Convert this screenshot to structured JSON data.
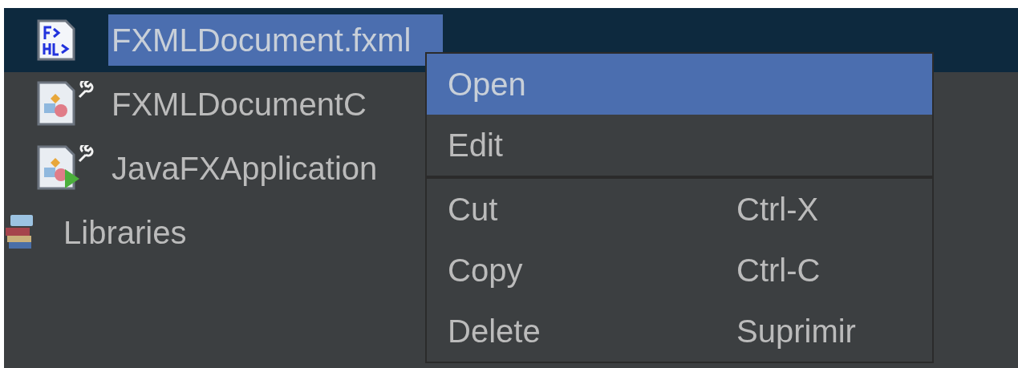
{
  "tree": {
    "items": [
      {
        "label": "FXMLDocument.fxml",
        "kind": "fxml",
        "selected": true
      },
      {
        "label": "FXMLDocumentC",
        "kind": "java",
        "selected": false
      },
      {
        "label": "JavaFXApplication",
        "kind": "java-main",
        "selected": false
      },
      {
        "label": "Libraries",
        "kind": "libraries",
        "selected": false
      }
    ]
  },
  "context_menu": {
    "items": [
      {
        "kind": "item",
        "label": "Open",
        "selected": true
      },
      {
        "kind": "item",
        "label": "Edit",
        "selected": false
      },
      {
        "kind": "separator"
      },
      {
        "kind": "item",
        "label": "Cut",
        "shortcut": "Ctrl-X",
        "selected": false
      },
      {
        "kind": "item",
        "label": "Copy",
        "shortcut": "Ctrl-C",
        "selected": false
      },
      {
        "kind": "item",
        "label": "Delete",
        "shortcut": "Suprimir",
        "selected": false
      }
    ]
  }
}
